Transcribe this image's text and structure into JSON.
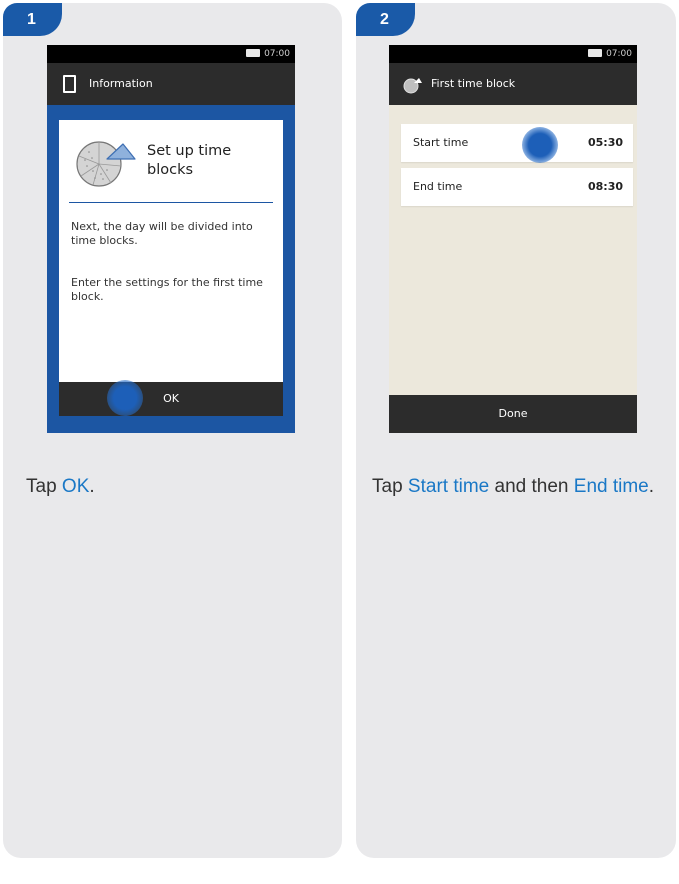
{
  "colors": {
    "badge": "#1a5aa8",
    "panel": "#e9e9eb",
    "highlight": "#1a78c6",
    "touch_dot": "#1d5fb8"
  },
  "step1": {
    "badge": "1",
    "phone": {
      "status_time": "07:00",
      "title_icon": "book-icon",
      "title": "Information",
      "dialog_icon": "pie-chart-icon",
      "dialog_title": "Set up time blocks",
      "paragraph1": "Next, the day will be divided into time blocks.",
      "paragraph2": "Enter the settings for the first time block.",
      "ok_button": "OK"
    },
    "instruction": {
      "prefix": "Tap ",
      "highlight": "OK",
      "suffix": "."
    }
  },
  "step2": {
    "badge": "2",
    "phone": {
      "status_time": "07:00",
      "title_icon": "pie-chart-icon",
      "title": "First time block",
      "rows": [
        {
          "label": "Start time",
          "value": "05:30"
        },
        {
          "label": "End time",
          "value": "08:30"
        }
      ],
      "done_button": "Done"
    },
    "instruction": {
      "prefix": "Tap ",
      "highlight1": "Start time",
      "middle": " and then ",
      "highlight2": "End time",
      "suffix": "."
    }
  }
}
